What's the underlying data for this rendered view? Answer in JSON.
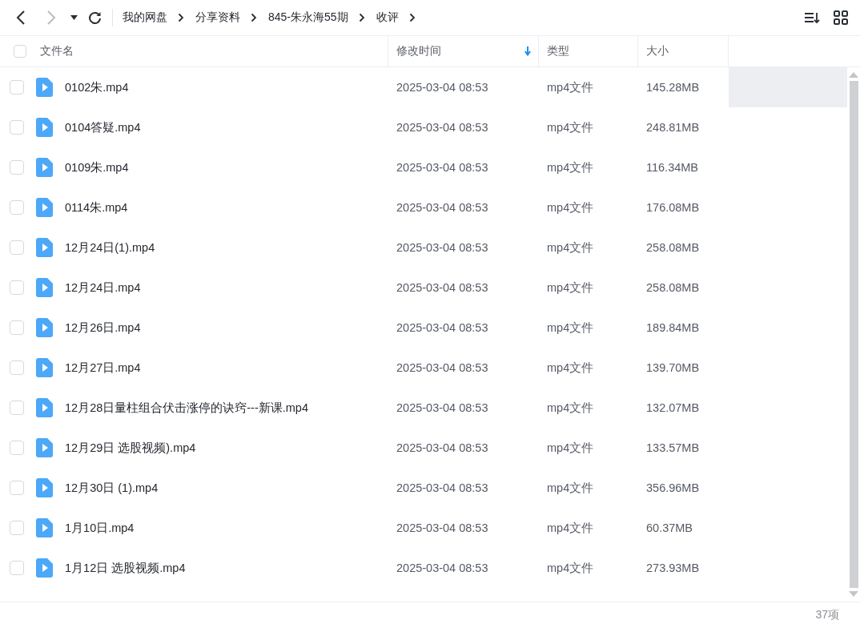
{
  "breadcrumb": [
    "我的网盘",
    "分享资料",
    "845-朱永海55期",
    "收评"
  ],
  "table": {
    "select_all_checked": false,
    "columns": [
      {
        "label": "文件名",
        "sorted": false
      },
      {
        "label": "修改时间",
        "sorted": true
      },
      {
        "label": "类型",
        "sorted": false
      },
      {
        "label": "大小",
        "sorted": false
      }
    ],
    "rows": [
      {
        "name": "0102朱.mp4",
        "modified": "2025-03-04 08:53",
        "type": "mp4文件",
        "size": "145.28MB",
        "checked": false,
        "hovered": true
      },
      {
        "name": "0104答疑.mp4",
        "modified": "2025-03-04 08:53",
        "type": "mp4文件",
        "size": "248.81MB",
        "checked": false,
        "hovered": false
      },
      {
        "name": "0109朱.mp4",
        "modified": "2025-03-04 08:53",
        "type": "mp4文件",
        "size": "116.34MB",
        "checked": false,
        "hovered": false
      },
      {
        "name": "0114朱.mp4",
        "modified": "2025-03-04 08:53",
        "type": "mp4文件",
        "size": "176.08MB",
        "checked": false,
        "hovered": false
      },
      {
        "name": "12月24日(1).mp4",
        "modified": "2025-03-04 08:53",
        "type": "mp4文件",
        "size": "258.08MB",
        "checked": false,
        "hovered": false
      },
      {
        "name": "12月24日.mp4",
        "modified": "2025-03-04 08:53",
        "type": "mp4文件",
        "size": "258.08MB",
        "checked": false,
        "hovered": false
      },
      {
        "name": "12月26日.mp4",
        "modified": "2025-03-04 08:53",
        "type": "mp4文件",
        "size": "189.84MB",
        "checked": false,
        "hovered": false
      },
      {
        "name": "12月27日.mp4",
        "modified": "2025-03-04 08:53",
        "type": "mp4文件",
        "size": "139.70MB",
        "checked": false,
        "hovered": false
      },
      {
        "name": "12月28日量柱组合伏击涨停的诀窍---新课.mp4",
        "modified": "2025-03-04 08:53",
        "type": "mp4文件",
        "size": "132.07MB",
        "checked": false,
        "hovered": false
      },
      {
        "name": "12月29日 选股视频).mp4",
        "modified": "2025-03-04 08:53",
        "type": "mp4文件",
        "size": "133.57MB",
        "checked": false,
        "hovered": false
      },
      {
        "name": "12月30日 (1).mp4",
        "modified": "2025-03-04 08:53",
        "type": "mp4文件",
        "size": "356.96MB",
        "checked": false,
        "hovered": false
      },
      {
        "name": "1月10日.mp4",
        "modified": "2025-03-04 08:53",
        "type": "mp4文件",
        "size": "60.37MB",
        "checked": false,
        "hovered": false
      },
      {
        "name": "1月12日 选股视频.mp4",
        "modified": "2025-03-04 08:53",
        "type": "mp4文件",
        "size": "273.93MB",
        "checked": false,
        "hovered": false
      }
    ]
  },
  "status_bar": {
    "count": "37项"
  }
}
